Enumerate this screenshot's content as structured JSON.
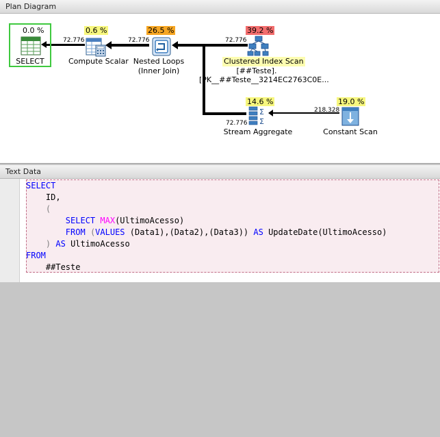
{
  "plan_pane": {
    "title": "Plan Diagram"
  },
  "text_pane": {
    "title": "Text Data"
  },
  "colors": {
    "low": "#f7f77e",
    "mid": "#f6a623",
    "high": "#f26d6d",
    "selected_border": "#3ec93e"
  },
  "operators": {
    "select": {
      "percent": "0.0 %",
      "label": "SELECT"
    },
    "compute_scalar": {
      "percent": "0.6 %",
      "label": "Compute Scalar"
    },
    "nested_loops": {
      "percent": "26.5 %",
      "label": "Nested Loops",
      "sublabel": "(Inner Join)"
    },
    "clustered_index_scan": {
      "percent": "39.2 %",
      "label": "Clustered Index Scan",
      "sublabel": "[##Teste].",
      "sublabel2": "[PK__##Teste__3214EC2763C0E..."
    },
    "stream_aggregate": {
      "percent": "14.6 %",
      "label": "Stream Aggregate"
    },
    "constant_scan": {
      "percent": "19.0 %",
      "label": "Constant Scan"
    }
  },
  "row_counts": {
    "compute_to_select": "72.776",
    "nested_to_compute": "72.776",
    "index_to_nested": "72.776",
    "aggregate_to_nested": "72.776",
    "constant_to_aggregate": "218.328"
  },
  "sql": {
    "line1": "SELECT",
    "line2": "ID,",
    "line3": "(",
    "line4_kw": "SELECT",
    "line4_fn": "MAX",
    "line4_rest": "(UltimoAcesso)",
    "line5_kw1": "FROM",
    "line5_p1": "(",
    "line5_kw2": "VALUES",
    "line5_p2": "(Data1),(Data2),(Data3))",
    "line5_kw3": "AS",
    "line5_rest": "UpdateDate(UltimoAcesso)",
    "line6_p": ")",
    "line6_kw": "AS",
    "line6_rest": "UltimoAcesso",
    "line7": "FROM",
    "line8": "##Teste"
  }
}
